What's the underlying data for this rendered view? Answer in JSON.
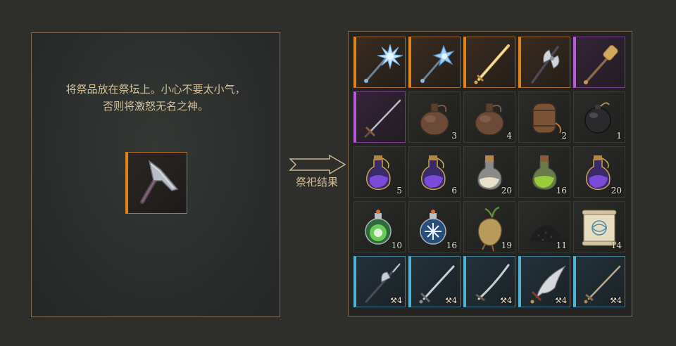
{
  "altar": {
    "instruction_line1": "将祭品放在祭坛上。小心不要太小气，",
    "instruction_line2": "否则将激怒无名之神。",
    "offered_item": {
      "icon": "pickaxe-icon",
      "rarity_color": "#e1831c"
    }
  },
  "arrow": {
    "label": "祭祀结果"
  },
  "rarity_colors": {
    "orange": "#e1831c",
    "purple": "#b75ad8",
    "blue": "#4fb3d6"
  },
  "result_grid": {
    "rows": [
      [
        {
          "icon": "spiked-mace-icon",
          "rarity": "orange",
          "count": ""
        },
        {
          "icon": "star-mace-icon",
          "rarity": "orange",
          "count": ""
        },
        {
          "icon": "golden-sword-icon",
          "rarity": "orange",
          "count": ""
        },
        {
          "icon": "double-axe-icon",
          "rarity": "orange",
          "count": ""
        },
        {
          "icon": "flanged-mace-icon",
          "rarity": "purple",
          "count": ""
        }
      ],
      [
        {
          "icon": "longsword-icon",
          "rarity": "purple",
          "count": ""
        },
        {
          "icon": "flask-icon",
          "rarity": "",
          "count": "3"
        },
        {
          "icon": "flask-icon",
          "rarity": "",
          "count": "4"
        },
        {
          "icon": "barrel-icon",
          "rarity": "",
          "count": "2"
        },
        {
          "icon": "bomb-icon",
          "rarity": "",
          "count": "1"
        }
      ],
      [
        {
          "icon": "purple-potion-icon",
          "rarity": "",
          "count": "5"
        },
        {
          "icon": "purple-potion-icon",
          "rarity": "",
          "count": "6"
        },
        {
          "icon": "white-potion-icon",
          "rarity": "",
          "count": "20"
        },
        {
          "icon": "green-potion-icon",
          "rarity": "",
          "count": "16"
        },
        {
          "icon": "purple-potion-icon",
          "rarity": "",
          "count": "20"
        }
      ],
      [
        {
          "icon": "green-orb-potion-icon",
          "rarity": "",
          "count": "10"
        },
        {
          "icon": "frost-orb-potion-icon",
          "rarity": "",
          "count": "16"
        },
        {
          "icon": "mandrake-root-icon",
          "rarity": "",
          "count": "19"
        },
        {
          "icon": "black-powder-icon",
          "rarity": "",
          "count": "11"
        },
        {
          "icon": "scroll-icon",
          "rarity": "",
          "count": "14"
        }
      ],
      [
        {
          "icon": "halberd-icon",
          "rarity": "blue",
          "durability": "4"
        },
        {
          "icon": "sword-icon",
          "rarity": "blue",
          "durability": "4"
        },
        {
          "icon": "curved-sword-icon",
          "rarity": "blue",
          "durability": "4"
        },
        {
          "icon": "scimitar-icon",
          "rarity": "blue",
          "durability": "4"
        },
        {
          "icon": "rapier-icon",
          "rarity": "blue",
          "durability": "4"
        }
      ]
    ]
  }
}
